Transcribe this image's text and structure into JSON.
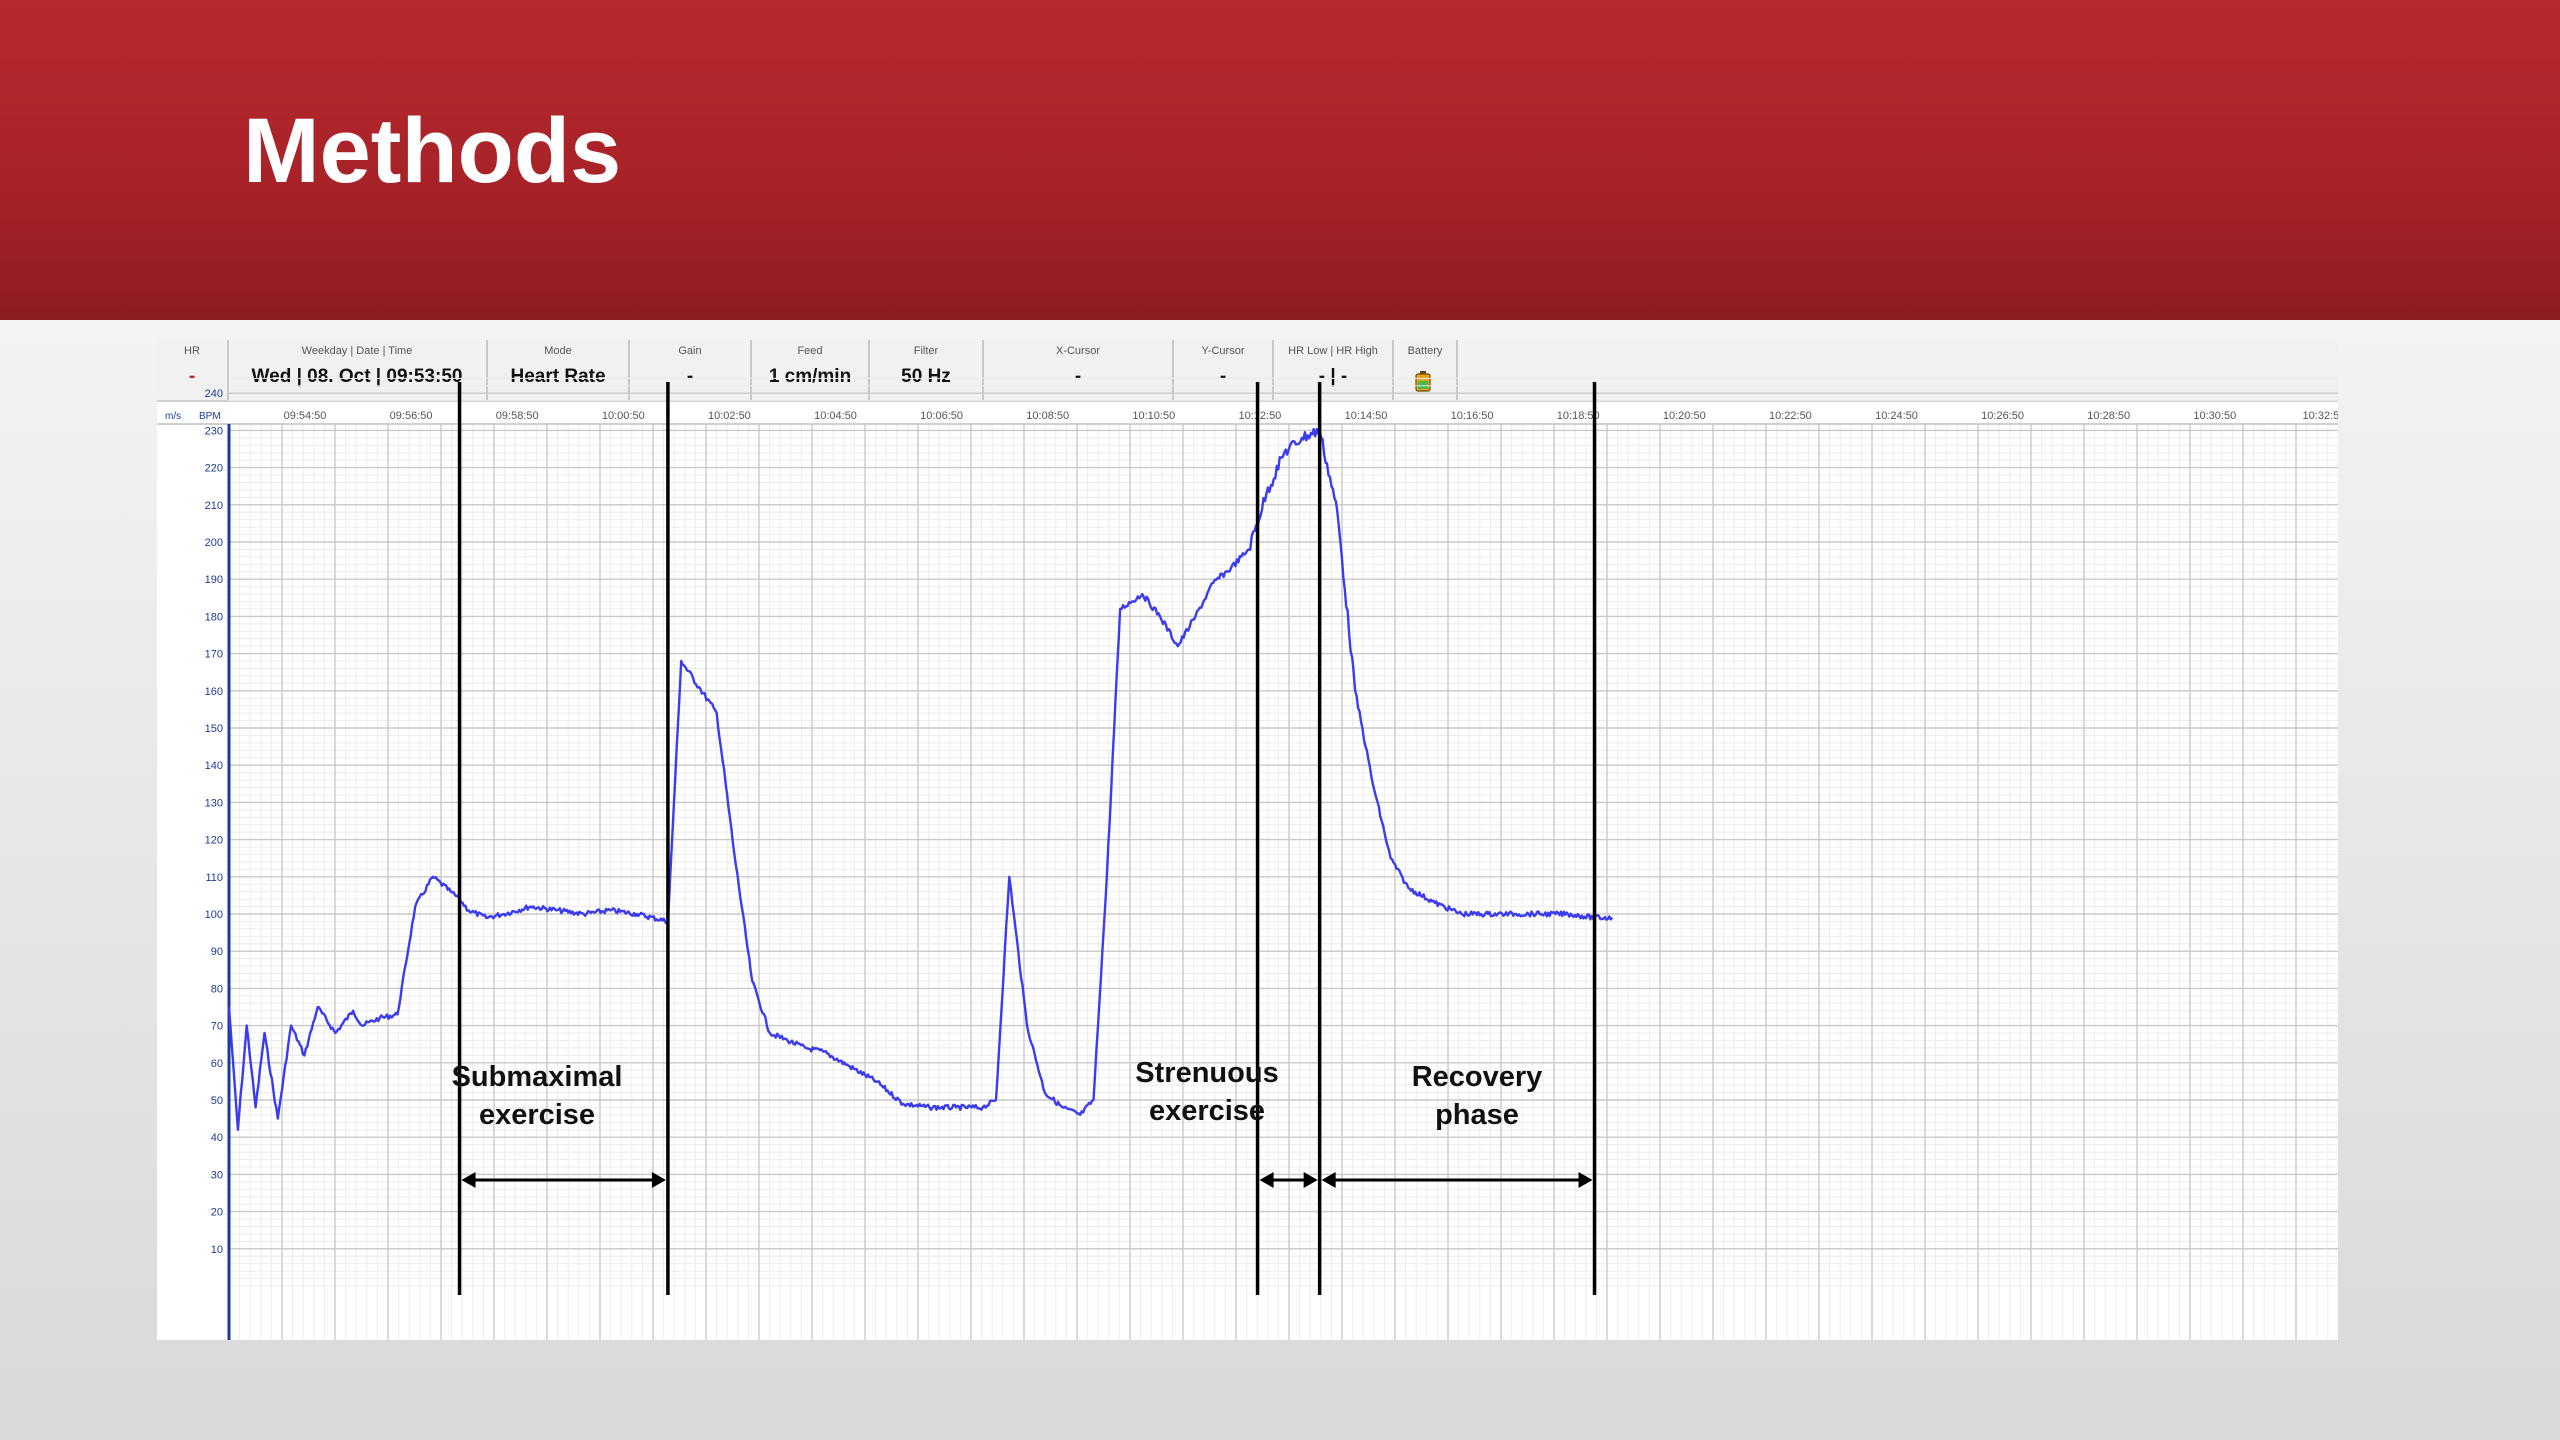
{
  "slide": {
    "title": "Methods"
  },
  "toolbar": {
    "hr": {
      "label": "HR",
      "value": "-"
    },
    "datetime": {
      "label": "Weekday | Date | Time",
      "value": "Wed | 08. Oct | 09:53:50"
    },
    "mode": {
      "label": "Mode",
      "value": "Heart Rate"
    },
    "gain": {
      "label": "Gain",
      "value": "-"
    },
    "feed": {
      "label": "Feed",
      "value": "1 cm/min"
    },
    "filter": {
      "label": "Filter",
      "value": "50 Hz"
    },
    "xcursor": {
      "label": "X-Cursor",
      "value": "-"
    },
    "ycursor": {
      "label": "Y-Cursor",
      "value": "-"
    },
    "hrlimits": {
      "label": "HR Low | HR High",
      "value": "- | -"
    },
    "battery": {
      "label": "Battery",
      "icon": "battery-icon"
    }
  },
  "colors": {
    "title_bar": "#b0262c",
    "trace": "#3b3bf0",
    "axis": "#1e3a9a",
    "hr_dash": "#cc1f1f"
  },
  "chart_data": {
    "type": "line",
    "title": "",
    "xlabel": "",
    "ylabel": "BPM",
    "units": [
      "m/s",
      "BPM"
    ],
    "ylim": [
      0,
      245
    ],
    "y_ticks": [
      10,
      20,
      30,
      40,
      50,
      60,
      70,
      80,
      90,
      100,
      110,
      120,
      130,
      140,
      150,
      160,
      170,
      180,
      190,
      200,
      210,
      220,
      230,
      240
    ],
    "x_ticks": [
      "09:54:50",
      "09:56:50",
      "09:58:50",
      "10:00:50",
      "10:02:50",
      "10:04:50",
      "10:06:50",
      "10:08:50",
      "10:10:50",
      "10:12:50",
      "10:14:50",
      "10:16:50",
      "10:18:50",
      "10:20:50",
      "10:22:50",
      "10:24:50",
      "10:26:50",
      "10:28:50",
      "10:30:50",
      "10:32:5"
    ],
    "grid": true,
    "series": [
      {
        "x": [
          "09:53:50",
          "09:54:00",
          "09:54:10",
          "09:54:20",
          "09:54:30",
          "09:54:45",
          "09:55:00",
          "09:55:15",
          "09:55:30",
          "09:55:50",
          "09:56:10",
          "09:56:20",
          "09:56:40",
          "09:57:00",
          "09:57:20",
          "09:57:40",
          "09:58:00",
          "09:58:10",
          "09:58:20",
          "09:58:40",
          "09:59:00",
          "09:59:30",
          "10:00:00",
          "10:00:30",
          "10:01:00",
          "10:01:30",
          "10:02:05",
          "10:02:20",
          "10:02:40",
          "10:03:00",
          "10:03:20",
          "10:03:40",
          "10:04:00",
          "10:04:20",
          "10:04:40",
          "10:05:00",
          "10:05:30",
          "10:06:00",
          "10:06:30",
          "10:07:00",
          "10:07:30",
          "10:08:00",
          "10:08:15",
          "10:08:30",
          "10:08:50",
          "10:09:10",
          "10:09:30",
          "10:09:50",
          "10:10:05",
          "10:10:20",
          "10:10:35",
          "10:11:00",
          "10:11:20",
          "10:11:40",
          "10:12:00",
          "10:12:20",
          "10:12:40",
          "10:13:00",
          "10:13:20",
          "10:13:40",
          "10:14:00",
          "10:14:20",
          "10:14:40",
          "10:15:00",
          "10:15:20",
          "10:15:40",
          "10:16:00",
          "10:16:30",
          "10:17:00",
          "10:17:30",
          "10:18:00",
          "10:18:30",
          "10:19:00",
          "10:19:30",
          "10:19:50"
        ],
        "y": [
          75,
          42,
          70,
          48,
          68,
          45,
          70,
          62,
          75,
          68,
          74,
          70,
          72,
          73,
          102,
          110,
          106,
          104,
          101,
          99,
          100,
          102,
          101,
          100,
          101,
          100,
          98,
          168,
          161,
          154,
          116,
          82,
          68,
          66,
          64,
          63,
          59,
          55,
          49,
          48,
          48,
          48,
          50,
          110,
          70,
          52,
          48,
          46,
          50,
          110,
          182,
          186,
          180,
          172,
          180,
          189,
          193,
          198,
          213,
          224,
          228,
          230,
          208,
          160,
          135,
          115,
          107,
          103,
          100,
          100,
          100,
          100,
          100,
          99,
          99
        ]
      }
    ]
  },
  "phases": [
    {
      "label": "Submaximal exercise"
    },
    {
      "label": ""
    },
    {
      "label": "Strenuous exercise"
    },
    {
      "label": "Recovery phase"
    }
  ]
}
